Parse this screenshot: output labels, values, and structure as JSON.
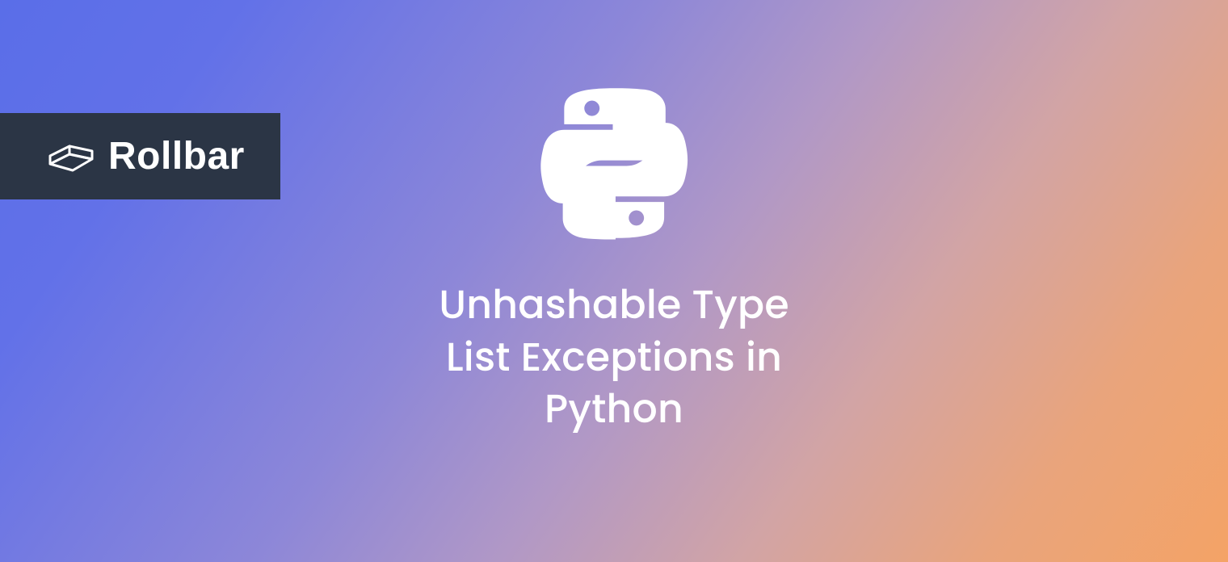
{
  "brand": {
    "name": "Rollbar"
  },
  "title_lines": {
    "l1": "Unhashable Type",
    "l2": "List Exceptions in",
    "l3": "Python"
  },
  "colors": {
    "badge_bg": "#2b3545",
    "text": "#ffffff"
  }
}
